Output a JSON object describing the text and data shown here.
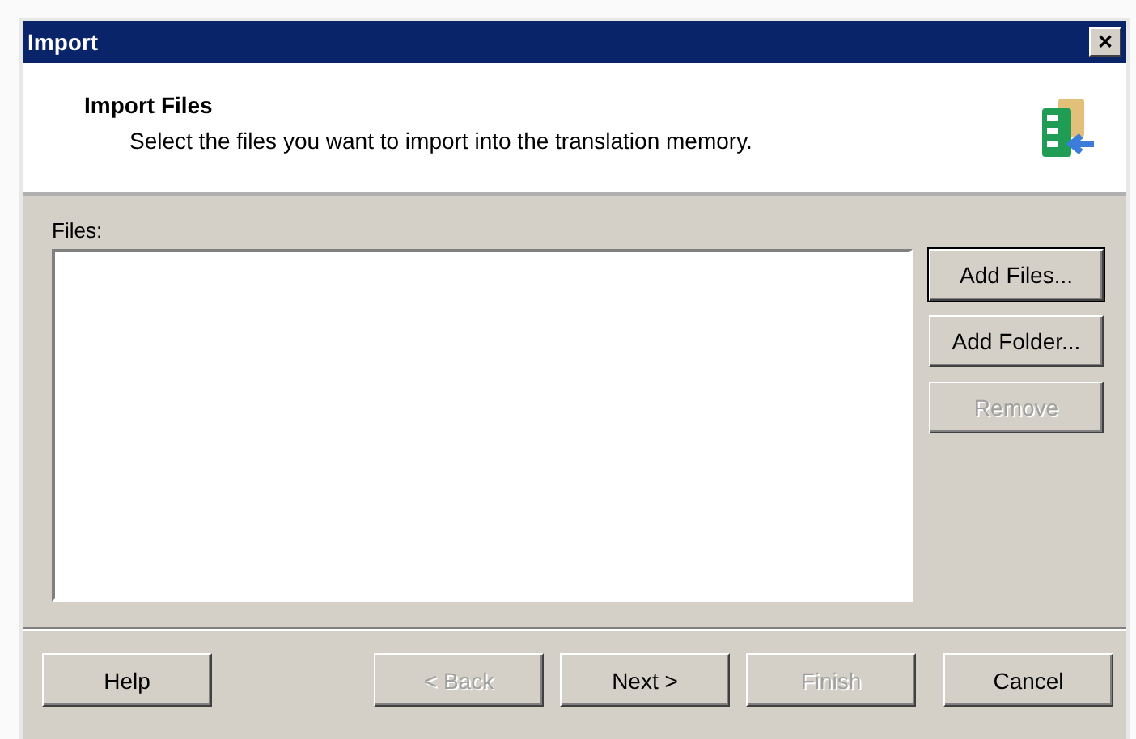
{
  "window": {
    "title": "Import",
    "close": "✕"
  },
  "header": {
    "title": "Import Files",
    "subtitle": "Select the files you want to import into the translation memory."
  },
  "files": {
    "label": "Files:"
  },
  "side_buttons": [
    {
      "label": "Add Files...",
      "disabled": false,
      "default": true
    },
    {
      "label": "Add Folder...",
      "disabled": false,
      "default": false
    },
    {
      "label": "Remove",
      "disabled": true,
      "default": false
    }
  ],
  "footer_buttons": [
    {
      "label": "Help",
      "disabled": false
    },
    {
      "label": "< Back",
      "disabled": true
    },
    {
      "label": "Next >",
      "disabled": false
    },
    {
      "label": "Finish",
      "disabled": true
    },
    {
      "label": "Cancel",
      "disabled": false
    }
  ]
}
